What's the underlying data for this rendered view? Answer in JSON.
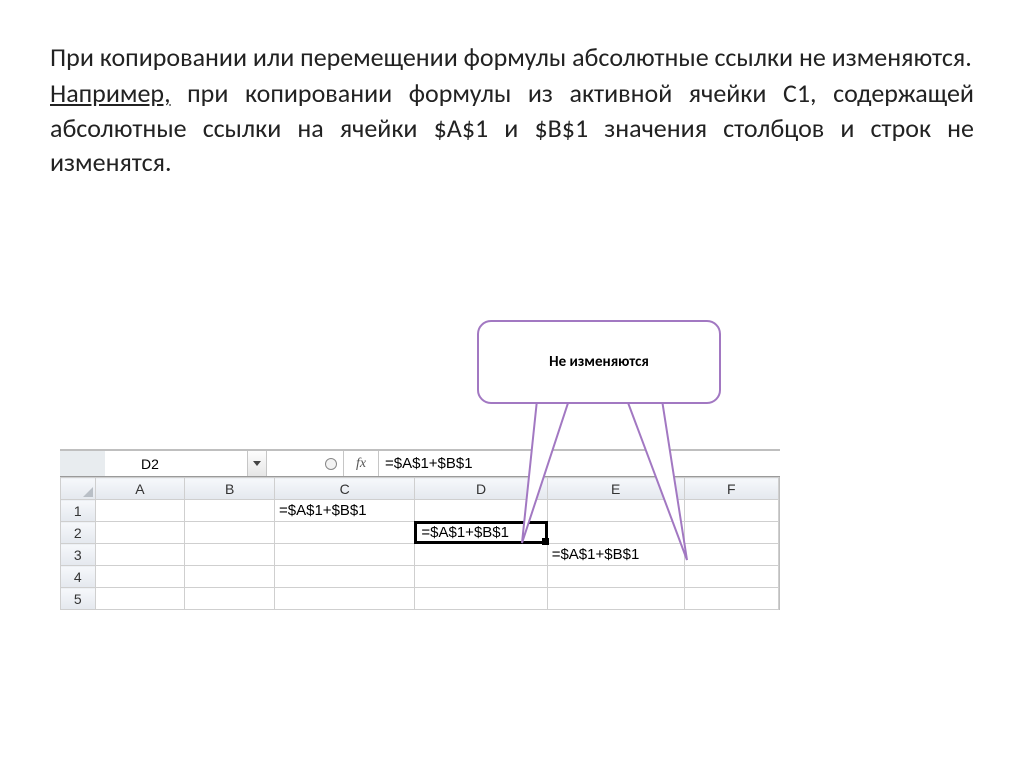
{
  "paragraph1": "При копировании или перемещении формулы абсолютные ссылки не  изменяются.",
  "paragraph2_lead": " Например,",
  "paragraph2_rest": " при  копировании формулы из активной ячейки C1, содержащей абсолютные ссылки на ячейки $A$1  и $B$1 значения столбцов и строк не изменятся.",
  "callout_text": "Не изменяются",
  "excel": {
    "name_box": "D2",
    "fx_label": "fx",
    "formula_bar": "=$A$1+$B$1",
    "columns": [
      "A",
      "B",
      "C",
      "D",
      "E",
      "F"
    ],
    "rows": [
      "1",
      "2",
      "3",
      "4",
      "5"
    ],
    "cells": {
      "C1": "=$A$1+$B$1",
      "D2": "=$A$1+$B$1",
      "E3": "=$A$1+$B$1"
    },
    "active_col": "D",
    "active_row": "2"
  }
}
